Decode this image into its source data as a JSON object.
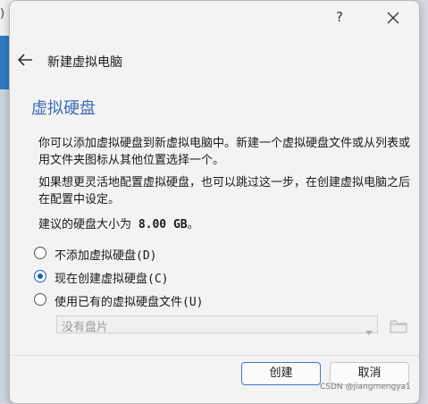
{
  "background": {
    "left_glyph": ")"
  },
  "titlebar": {
    "help_label": "?"
  },
  "nav": {
    "title": "新建虚拟电脑"
  },
  "page": {
    "title": "虚拟硬盘",
    "paragraph1": "你可以添加虚拟硬盘到新虚拟电脑中。新建一个虚拟硬盘文件或从列表或用文件夹图标从其他位置选择一个。",
    "paragraph2": "如果想更灵活地配置虚拟硬盘，也可以跳过这一步，在创建虚拟电脑之后在配置中设定。",
    "size_prefix": "建议的硬盘大小为 ",
    "size_value": "8.00 GB",
    "size_suffix": "。"
  },
  "options": [
    {
      "label": "不添加虚拟硬盘(D)",
      "checked": false
    },
    {
      "label": "现在创建虚拟硬盘(C)",
      "checked": true
    },
    {
      "label": "使用已有的虚拟硬盘文件(U)",
      "checked": false
    }
  ],
  "disk_select": {
    "selected": "没有盘片"
  },
  "buttons": {
    "create": "创建",
    "cancel": "取消"
  },
  "watermark": "CSDN @jiangmengya1",
  "colors": {
    "accent": "#1a5fb4",
    "title_blue": "#3d6bb7"
  },
  "icons": {
    "help": "help-icon",
    "close": "close-icon",
    "back": "back-arrow-icon",
    "dropdown": "chevron-down-icon",
    "folder": "folder-icon"
  }
}
